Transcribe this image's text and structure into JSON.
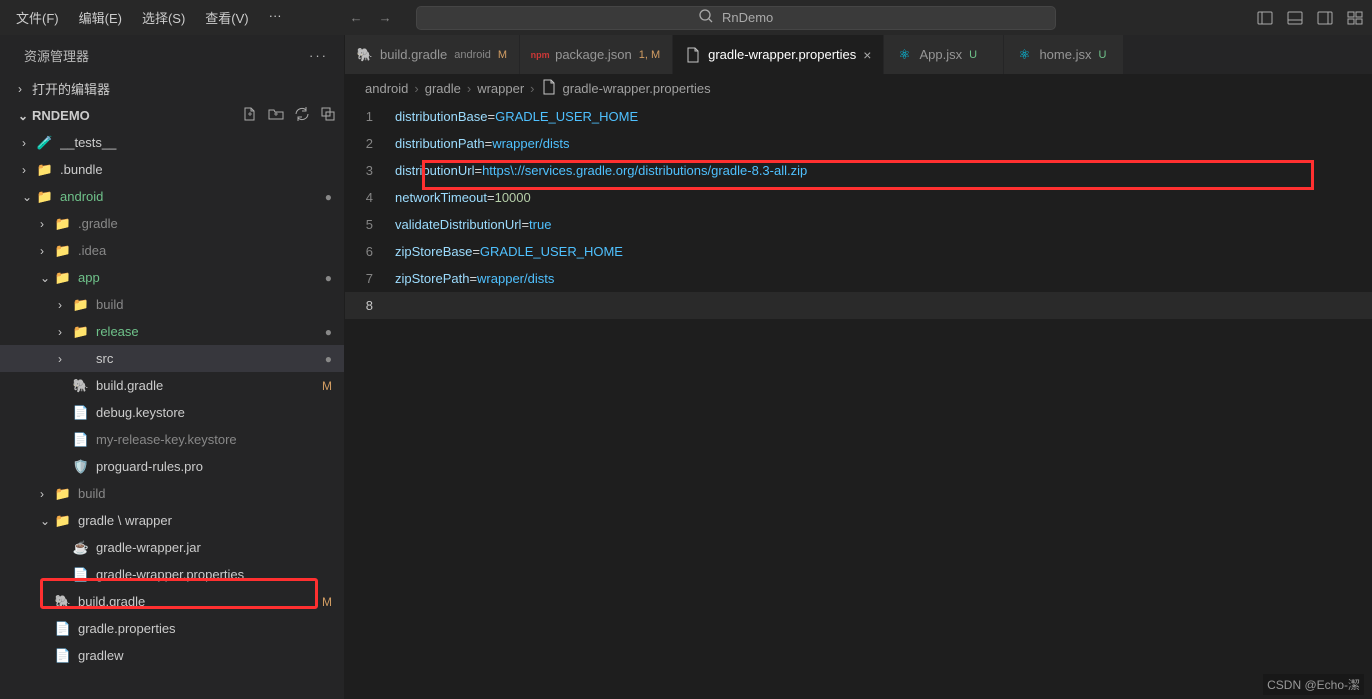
{
  "titlebar": {
    "menu": [
      "文件(F)",
      "编辑(E)",
      "选择(S)",
      "查看(V)",
      "···"
    ],
    "search": "RnDemo"
  },
  "sidebar": {
    "title": "资源管理器",
    "openEditors": "打开的编辑器",
    "project": "RNDEMO",
    "tree": [
      {
        "depth": 1,
        "chev": "›",
        "ico": "🧪",
        "name": "__tests__",
        "cls": ""
      },
      {
        "depth": 1,
        "chev": "›",
        "ico": "📁",
        "name": ".bundle",
        "cls": "",
        "icoCls": "folder-ico"
      },
      {
        "depth": 1,
        "chev": "⌄",
        "ico": "📁",
        "name": "android",
        "cls": "green",
        "badge": "●",
        "badgeCls": "dot-badge",
        "icoCls": "folder-ico-g"
      },
      {
        "depth": 2,
        "chev": "›",
        "ico": "📁",
        "name": ".gradle",
        "cls": "dim",
        "icoCls": "folder-ico"
      },
      {
        "depth": 2,
        "chev": "›",
        "ico": "📁",
        "name": ".idea",
        "cls": "dim",
        "icoCls": "folder-ico"
      },
      {
        "depth": 2,
        "chev": "⌄",
        "ico": "📁",
        "name": "app",
        "cls": "green",
        "badge": "●",
        "badgeCls": "dot-badge",
        "icoCls": "folder-ico-g"
      },
      {
        "depth": 3,
        "chev": "›",
        "ico": "📁",
        "name": "build",
        "cls": "dim",
        "icoCls": "folder-ico"
      },
      {
        "depth": 3,
        "chev": "›",
        "ico": "📁",
        "name": "release",
        "cls": "green",
        "badge": "●",
        "badgeCls": "dot-badge",
        "icoCls": "folder-ico"
      },
      {
        "depth": 3,
        "chev": "›",
        "ico": "</>",
        "name": "src",
        "cls": "",
        "badge": "●",
        "badgeCls": "dot-badge",
        "icoCls": "folder-ico-g",
        "sel": true
      },
      {
        "depth": 3,
        "chev": "",
        "ico": "🐘",
        "name": "build.gradle",
        "cls": "",
        "badge": "M",
        "badgeCls": "m-badge"
      },
      {
        "depth": 3,
        "chev": "",
        "ico": "📄",
        "name": "debug.keystore",
        "cls": ""
      },
      {
        "depth": 3,
        "chev": "",
        "ico": "📄",
        "name": "my-release-key.keystore",
        "cls": "dim"
      },
      {
        "depth": 3,
        "chev": "",
        "ico": "🛡️",
        "name": "proguard-rules.pro",
        "cls": ""
      },
      {
        "depth": 2,
        "chev": "›",
        "ico": "📁",
        "name": "build",
        "cls": "dim",
        "icoCls": "folder-ico"
      },
      {
        "depth": 2,
        "chev": "⌄",
        "ico": "📁",
        "name": "gradle \\ wrapper",
        "cls": "",
        "icoCls": "folder-ico"
      },
      {
        "depth": 3,
        "chev": "",
        "ico": "☕",
        "name": "gradle-wrapper.jar",
        "cls": ""
      },
      {
        "depth": 3,
        "chev": "",
        "ico": "📄",
        "name": "gradle-wrapper.properties",
        "cls": ""
      },
      {
        "depth": 2,
        "chev": "",
        "ico": "🐘",
        "name": "build.gradle",
        "cls": "",
        "badge": "M",
        "badgeCls": "m-badge"
      },
      {
        "depth": 2,
        "chev": "",
        "ico": "📄",
        "name": "gradle.properties",
        "cls": ""
      },
      {
        "depth": 2,
        "chev": "",
        "ico": "📄",
        "name": "gradlew",
        "cls": ""
      }
    ]
  },
  "tabs": [
    {
      "ico": "elephant",
      "label": "build.gradle",
      "hint": "android",
      "status": "M",
      "statusCls": "m-badge"
    },
    {
      "ico": "npm",
      "label": "package.json",
      "status": "1, M",
      "statusCls": "m-badge"
    },
    {
      "ico": "file",
      "label": "gradle-wrapper.properties",
      "active": true,
      "close": true
    },
    {
      "ico": "react",
      "label": "App.jsx",
      "status": "U",
      "statusCls": "green"
    },
    {
      "ico": "react",
      "label": "home.jsx",
      "status": "U",
      "statusCls": "green"
    }
  ],
  "breadcrumb": [
    "android",
    "gradle",
    "wrapper",
    "gradle-wrapper.properties"
  ],
  "code": [
    {
      "n": "1",
      "seg": [
        [
          "k",
          "distributionBase"
        ],
        [
          "e",
          "="
        ],
        [
          "v",
          "GRADLE_USER_HOME"
        ]
      ]
    },
    {
      "n": "2",
      "seg": [
        [
          "k",
          "distributionPath"
        ],
        [
          "e",
          "="
        ],
        [
          "v",
          "wrapper/dists"
        ]
      ]
    },
    {
      "n": "3",
      "seg": [
        [
          "k",
          "distributionUrl"
        ],
        [
          "e",
          "="
        ],
        [
          "v",
          "https\\://services.gradle.org/distributions/gradle-8.3-all.zip"
        ]
      ]
    },
    {
      "n": "4",
      "seg": [
        [
          "k",
          "networkTimeout"
        ],
        [
          "e",
          "="
        ],
        [
          "n",
          "10000"
        ]
      ]
    },
    {
      "n": "5",
      "seg": [
        [
          "k",
          "validateDistributionUrl"
        ],
        [
          "e",
          "="
        ],
        [
          "v",
          "true"
        ]
      ]
    },
    {
      "n": "6",
      "seg": [
        [
          "k",
          "zipStoreBase"
        ],
        [
          "e",
          "="
        ],
        [
          "v",
          "GRADLE_USER_HOME"
        ]
      ]
    },
    {
      "n": "7",
      "seg": [
        [
          "k",
          "zipStorePath"
        ],
        [
          "e",
          "="
        ],
        [
          "v",
          "wrapper/dists"
        ]
      ]
    },
    {
      "n": "8",
      "seg": [],
      "cur": true
    }
  ],
  "watermark": "CSDN @Echo-潔"
}
